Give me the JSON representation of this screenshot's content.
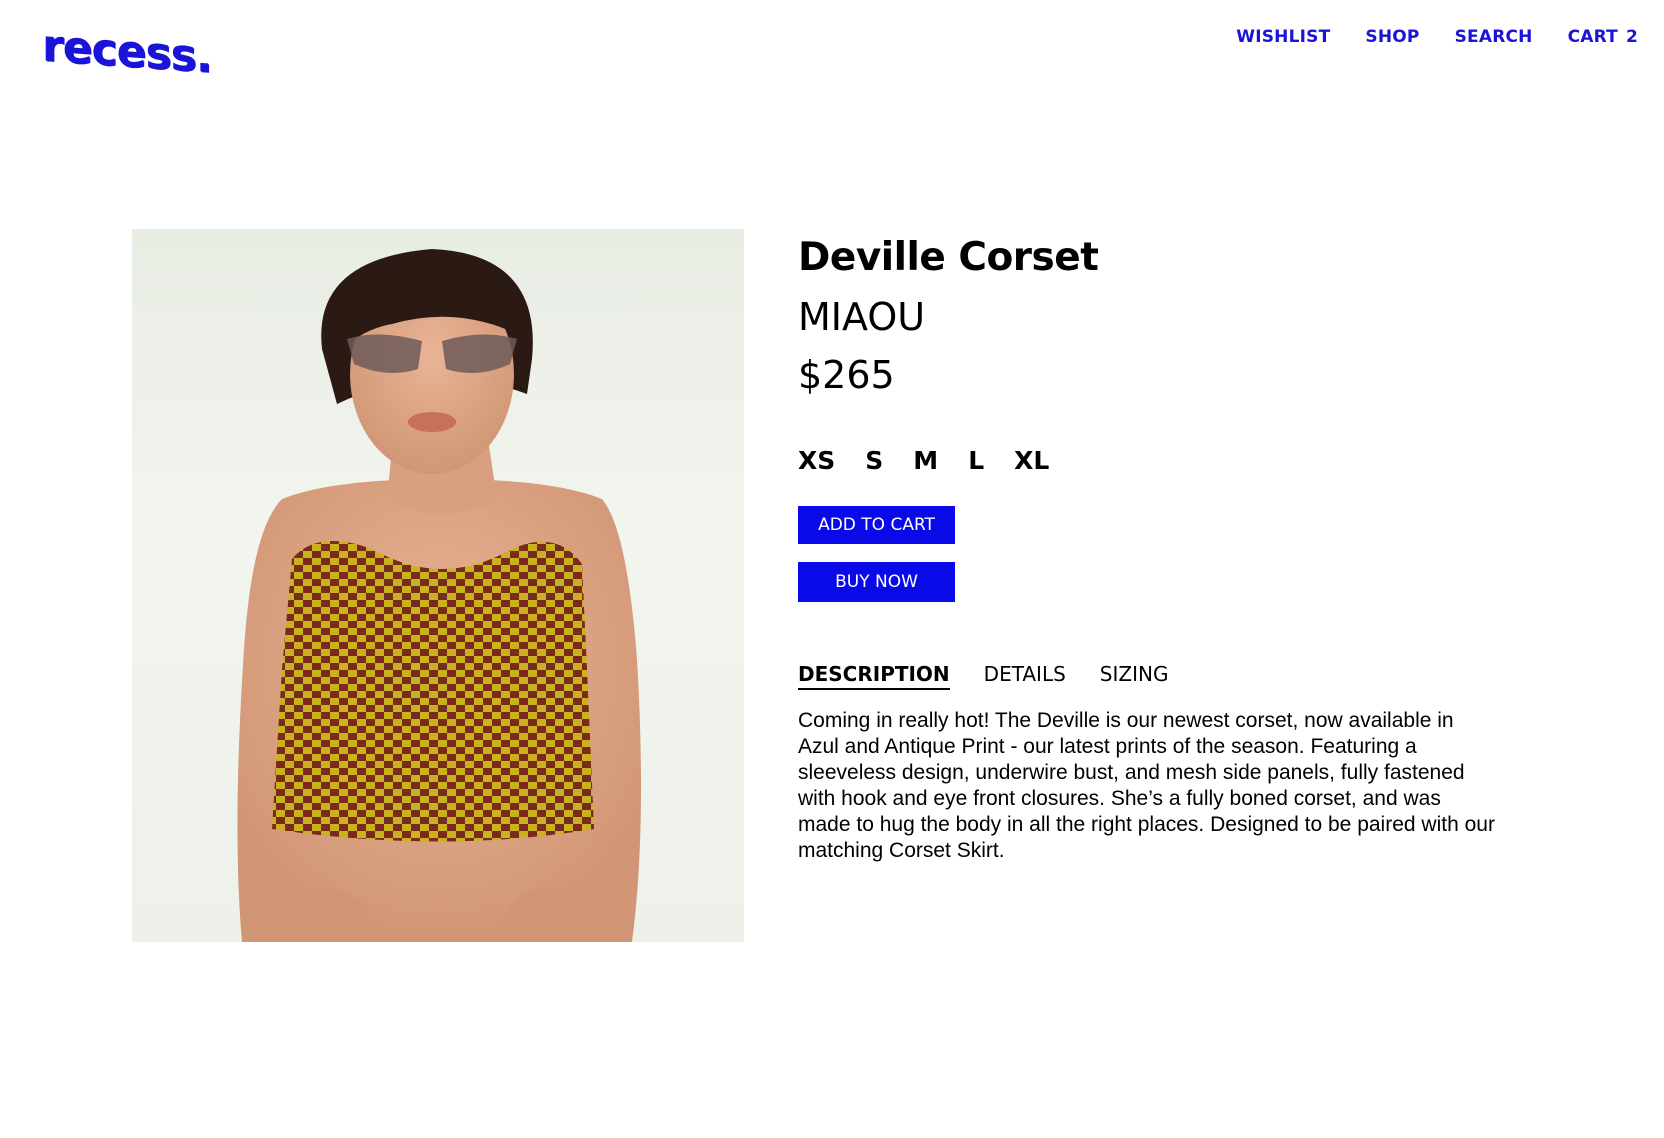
{
  "header": {
    "logo": "recess.",
    "nav": [
      {
        "label": "WISHLIST"
      },
      {
        "label": "SHOP"
      },
      {
        "label": "SEARCH"
      },
      {
        "label": "CART",
        "count": "2"
      }
    ]
  },
  "product": {
    "title": "Deville Corset",
    "brand": "MIAOU",
    "price": "$265",
    "sizes": [
      "XS",
      "S",
      "M",
      "L",
      "XL"
    ],
    "add_to_cart_label": "ADD TO CART",
    "buy_now_label": "BUY NOW",
    "tabs": [
      "DESCRIPTION",
      "DETAILS",
      "SIZING"
    ],
    "active_tab": "DESCRIPTION",
    "description": "Coming in really hot! The Deville is our newest corset, now available in Azul and Antique Print - our latest prints of the season. Featuring a sleeveless design, underwire bust, and mesh side panels, fully fastened with hook and eye front closures. She’s a fully boned corset, and was made to hug the body in all the right places. Designed to be paired with our matching Corset Skirt."
  },
  "colors": {
    "brand_blue": "#1a14d8",
    "button_blue": "#0a0ae8",
    "corset_yellow": "#c9b21e",
    "corset_brown": "#7a2a1c"
  }
}
